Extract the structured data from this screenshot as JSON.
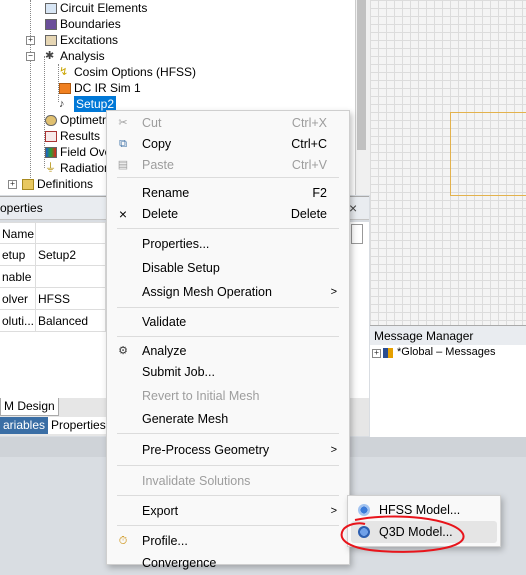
{
  "tree": {
    "items": [
      {
        "label": "Circuit Elements",
        "icon": "circuit-elements-icon"
      },
      {
        "label": "Boundaries",
        "icon": "boundaries-icon"
      },
      {
        "label": "Excitations",
        "icon": "excitations-icon"
      },
      {
        "label": "Analysis",
        "icon": "analysis-icon"
      },
      {
        "label": "Cosim Options (HFSS)",
        "icon": "cosim-options-icon"
      },
      {
        "label": "DC IR Sim 1",
        "icon": "dc-ir-sim-icon"
      },
      {
        "label": "Setup2",
        "icon": "setup-icon"
      },
      {
        "label": "Optimetric",
        "icon": "optimetrics-icon"
      },
      {
        "label": "Results",
        "icon": "results-icon"
      },
      {
        "label": "Field Overl",
        "icon": "field-overlays-icon"
      },
      {
        "label": "Radiation",
        "icon": "radiation-icon"
      },
      {
        "label": "Definitions",
        "icon": "folder-icon"
      }
    ]
  },
  "properties": {
    "title": "operties",
    "close": "×",
    "headers": [
      "Name",
      ""
    ],
    "rows": [
      {
        "name": "etup",
        "value": "Setup2"
      },
      {
        "name": "nable",
        "value": ""
      },
      {
        "name": "olver",
        "value": "HFSS"
      },
      {
        "name": "oluti...",
        "value": "Balanced"
      }
    ]
  },
  "bottom": {
    "design_tab": "M Design",
    "tabs": [
      "ariables",
      "Properties"
    ]
  },
  "messages": {
    "title": "Message Manager",
    "item": "*Global – Messages"
  },
  "menu": {
    "items": [
      {
        "label": "Cut",
        "shortcut": "Ctrl+X",
        "disabled": true,
        "icon": "scissors-icon"
      },
      {
        "label": "Copy",
        "shortcut": "Ctrl+C",
        "disabled": false,
        "icon": "copy-icon"
      },
      {
        "label": "Paste",
        "shortcut": "Ctrl+V",
        "disabled": true,
        "icon": "paste-icon"
      },
      {
        "label": "Rename",
        "shortcut": "F2",
        "disabled": false
      },
      {
        "label": "Delete",
        "shortcut": "Delete",
        "disabled": false,
        "icon": "delete-x-icon"
      },
      {
        "label": "Properties...",
        "disabled": false
      },
      {
        "label": "Disable Setup",
        "disabled": false
      },
      {
        "label": "Assign Mesh Operation",
        "disabled": false,
        "submenu": true
      },
      {
        "label": "Validate",
        "disabled": false
      },
      {
        "label": "Analyze",
        "disabled": false,
        "icon": "analyze-icon"
      },
      {
        "label": "Submit Job...",
        "disabled": false
      },
      {
        "label": "Revert to Initial Mesh",
        "disabled": true
      },
      {
        "label": "Generate Mesh",
        "disabled": false
      },
      {
        "label": "Pre-Process Geometry",
        "disabled": false,
        "submenu": true
      },
      {
        "label": "Invalidate Solutions",
        "disabled": true
      },
      {
        "label": "Export",
        "disabled": false,
        "submenu": true
      },
      {
        "label": "Profile...",
        "disabled": false,
        "icon": "profile-icon"
      },
      {
        "label": "Convergence",
        "disabled": false
      }
    ],
    "arrow": ">"
  },
  "submenu": {
    "items": [
      {
        "label": "HFSS Model...",
        "icon": "hfss-model-icon"
      },
      {
        "label": "Q3D Model...",
        "icon": "q3d-model-icon"
      }
    ]
  },
  "colors": {
    "selection": "#0078d7",
    "annotation": "#e8141b",
    "highlight": "#e5e5e5"
  }
}
